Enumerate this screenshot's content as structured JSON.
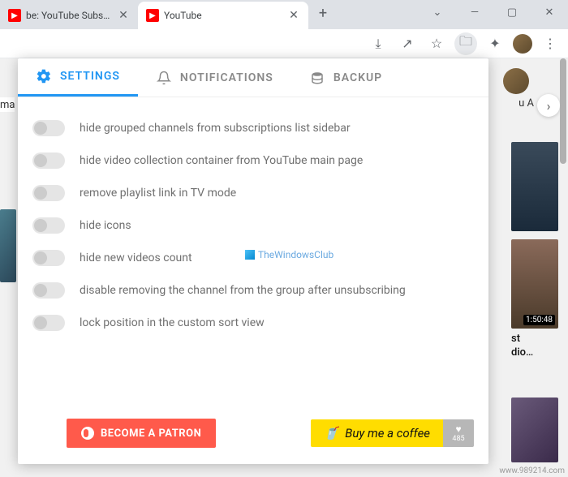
{
  "window": {
    "tabs": [
      {
        "title": "be: YouTube Subscriptio",
        "active": false
      },
      {
        "title": "YouTube",
        "active": true
      }
    ],
    "minimize": "—",
    "maximize": "▢",
    "chevron": "⌄",
    "close": "✕",
    "newtab": "+"
  },
  "toolbar_icons": [
    "download",
    "share",
    "star",
    "folder",
    "puzzle",
    "avatar",
    "more"
  ],
  "panel": {
    "tabs": {
      "settings": "SETTINGS",
      "notifications": "NOTIFICATIONS",
      "backup": "BACKUP"
    },
    "settings": [
      "hide grouped channels from subscriptions list sidebar",
      "hide video collection container from YouTube main page",
      "remove playlist link in TV mode",
      "hide icons",
      "hide new videos count",
      "disable removing the channel from the group after unsubscribing",
      "lock position in the custom sort view"
    ],
    "footer": {
      "patron": "BECOME A PATRON",
      "coffee": "Buy me a coffee",
      "likes": "485"
    }
  },
  "watermark": "TheWindowsClub",
  "bg": {
    "left_text": "ma",
    "right_text": "u A",
    "duration": "1:50:48",
    "caption": "st\ndio…"
  },
  "corner": "www.989214.com"
}
